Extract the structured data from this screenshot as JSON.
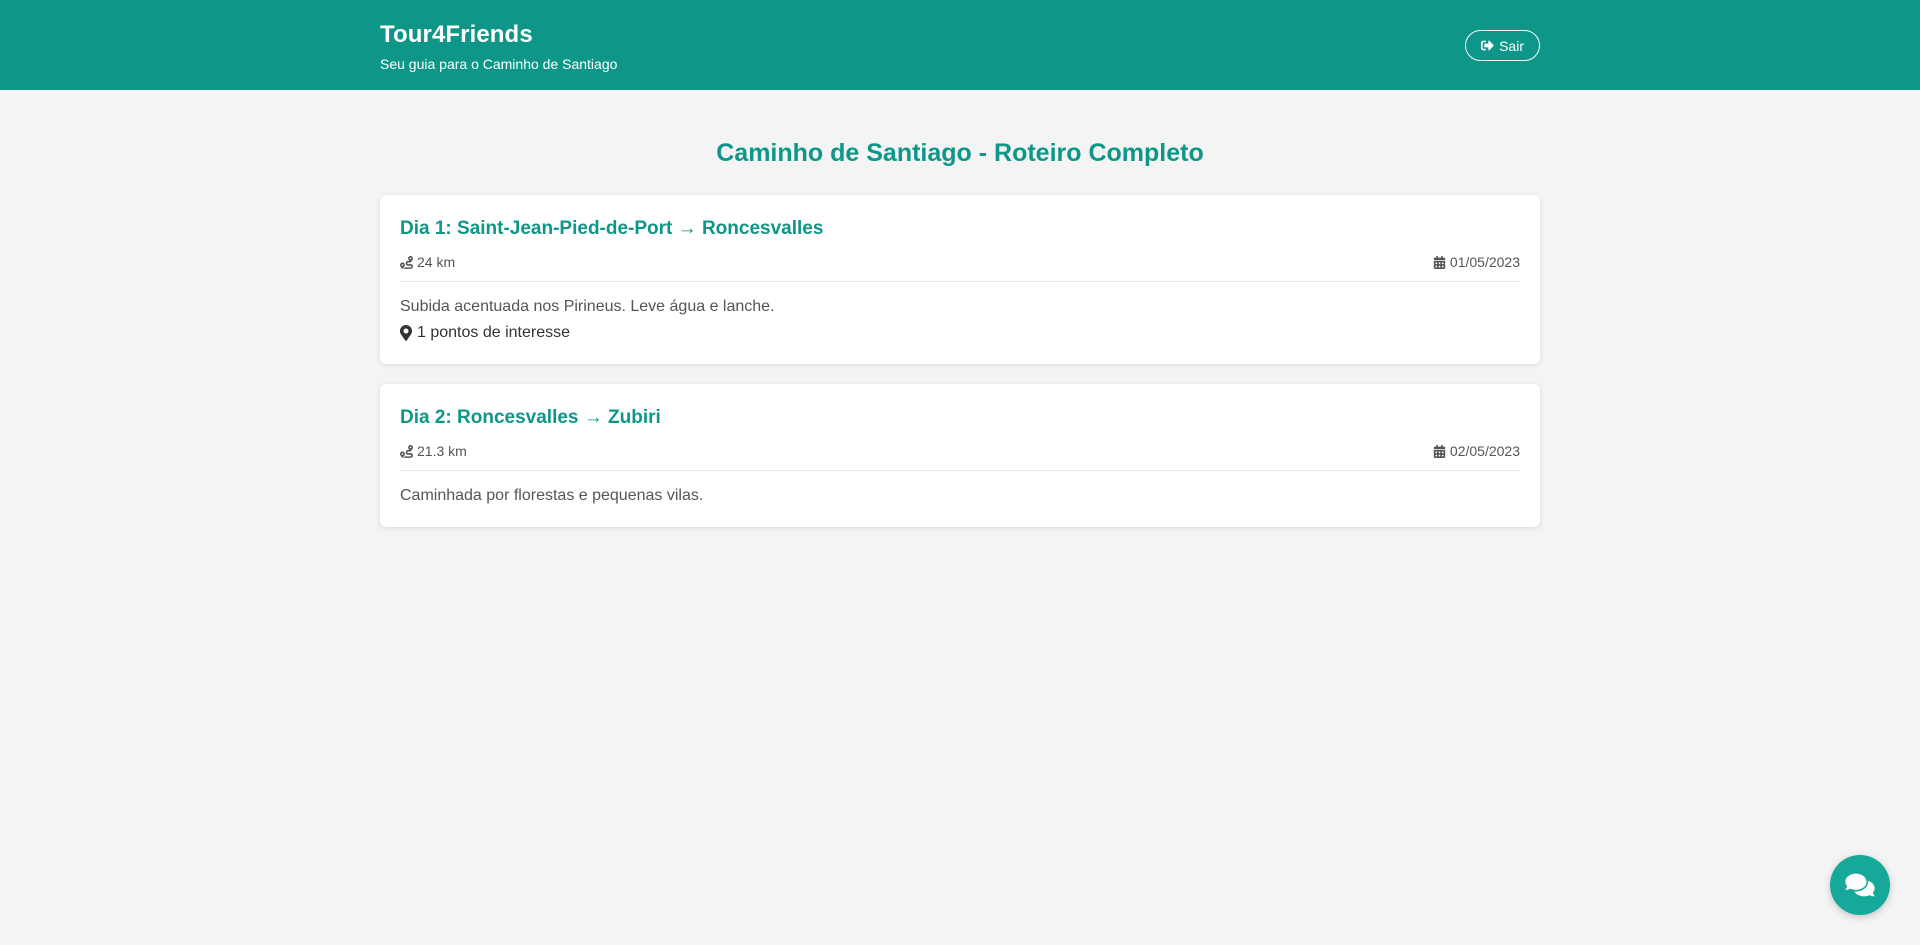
{
  "header": {
    "title": "Tour4Friends",
    "subtitle": "Seu guia para o Caminho de Santiago",
    "logout_label": "Sair",
    "logout_icon": "sign-out-icon",
    "background_color": "#0e9688"
  },
  "main": {
    "page_title": "Caminho de Santiago - Roteiro Completo",
    "stages": [
      {
        "title": "Dia 1: Saint-Jean-Pied-de-Port → Roncesvalles",
        "distance": "24 km",
        "date": "01/05/2023",
        "description": "Subida acentuada nos Pirineus. Leve água e lanche.",
        "poi": "1 pontos de interesse"
      },
      {
        "title": "Dia 2: Roncesvalles → Zubiri",
        "distance": "21.3 km",
        "date": "02/05/2023",
        "description": "Caminhada por florestas e pequenas vilas."
      }
    ]
  },
  "chat": {
    "icon": "chat-bubbles-icon",
    "color": "#16a99a"
  }
}
